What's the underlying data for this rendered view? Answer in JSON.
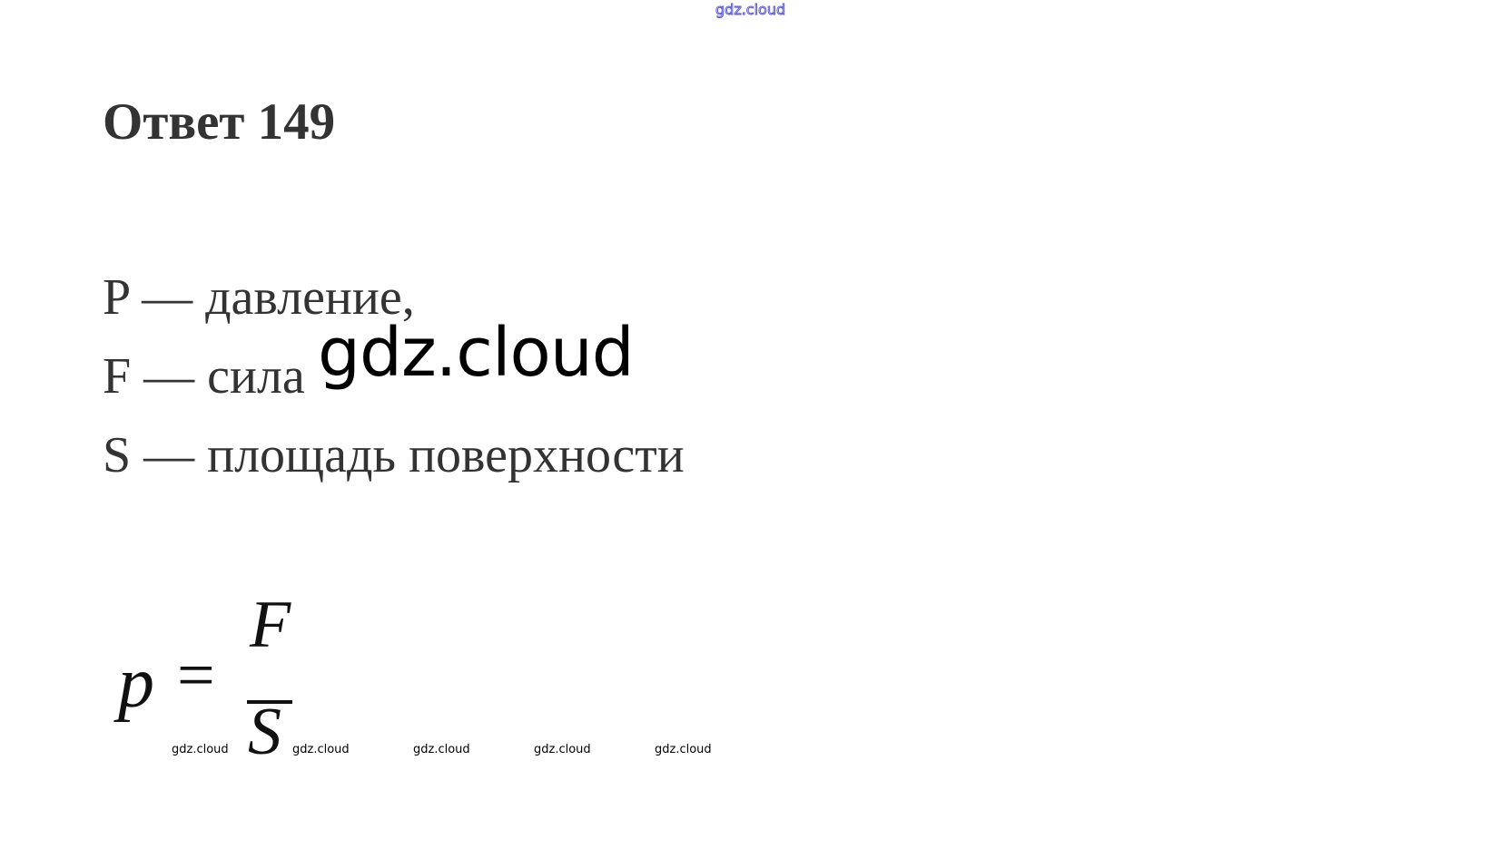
{
  "watermark": {
    "top": "gdz.cloud",
    "center": "gdz.cloud",
    "bottom": [
      "gdz.cloud",
      "gdz.cloud",
      "gdz.cloud",
      "gdz.cloud",
      "gdz.cloud"
    ]
  },
  "title": "Ответ 149",
  "definitions": [
    "P — давление,",
    "F — сила",
    "S — площадь поверхности"
  ],
  "formula": {
    "lhs": "p",
    "equals": "=",
    "numerator": "F",
    "denominator": "S"
  },
  "colors": {
    "text": "#333333",
    "formula": "#111111",
    "top_watermark_outline": "#5a5ad0"
  }
}
